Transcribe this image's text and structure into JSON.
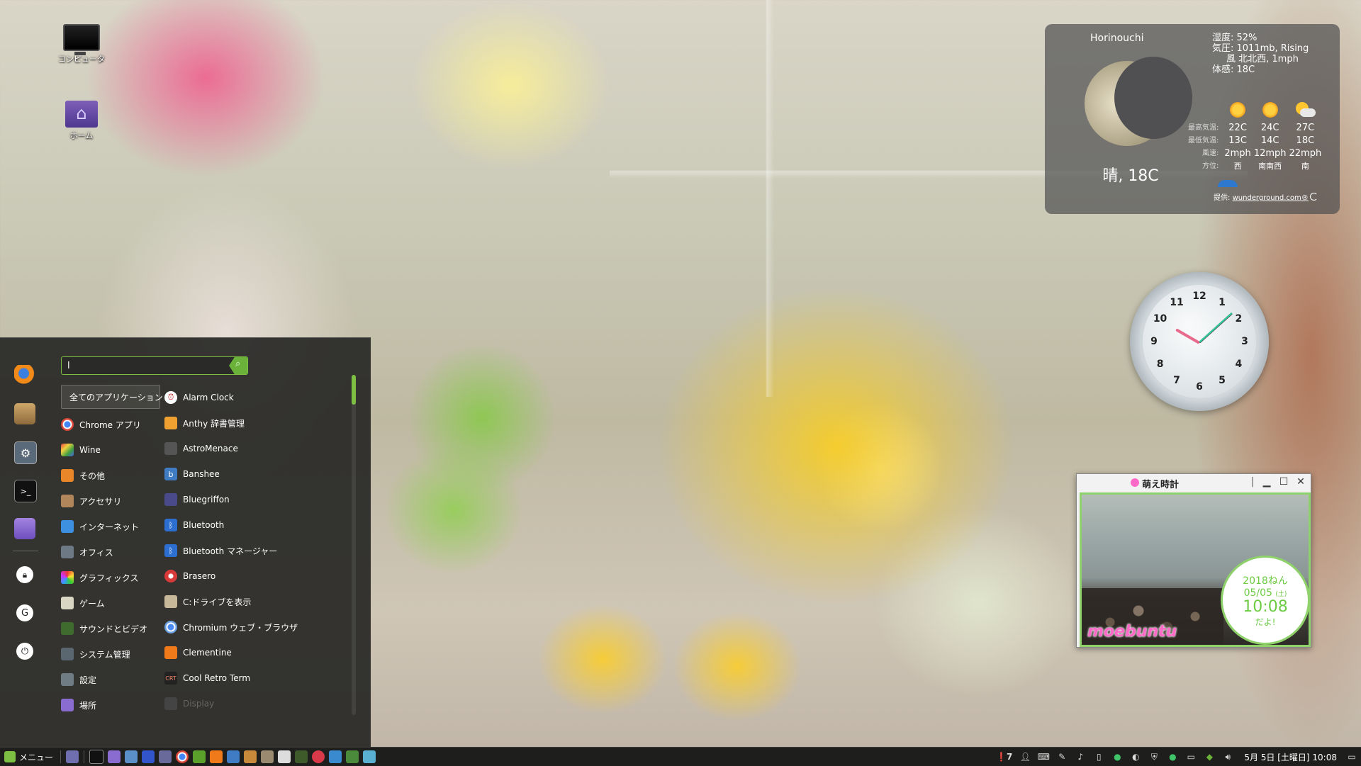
{
  "desktop": {
    "icons": [
      {
        "label": "コンピュータ"
      },
      {
        "label": "ホーム"
      }
    ]
  },
  "weather": {
    "city": "Horinouchi",
    "current": "晴, 18C",
    "details": [
      "湿度: 52%",
      "気圧: 1011mb, Rising",
      "風 北北西, 1mph",
      "体感: 18C"
    ],
    "row_labels": [
      "最高気温:",
      "最低気温:",
      "風速:",
      "方位:"
    ],
    "forecast": [
      {
        "icon": "sun-icon",
        "high": "22C",
        "low": "13C",
        "wind": "2mph",
        "dir": "西"
      },
      {
        "icon": "sun-icon",
        "high": "24C",
        "low": "14C",
        "wind": "12mph",
        "dir": "南南西"
      },
      {
        "icon": "partly-cloudy-icon",
        "high": "27C",
        "low": "18C",
        "wind": "22mph",
        "dir": "南"
      }
    ],
    "credit_prefix": "提供:",
    "credit_link": "wunderground.com®"
  },
  "analog_clock": {
    "numbers": [
      "12",
      "1",
      "2",
      "3",
      "4",
      "5",
      "6",
      "7",
      "8",
      "9",
      "10",
      "11"
    ]
  },
  "moe_clock": {
    "title": "萌え時計",
    "year": "2018ねん",
    "date": "05/05",
    "weekday": "(土)",
    "time": "10:08",
    "suffix": "だよ!",
    "logo": "moebuntu"
  },
  "menu": {
    "search_value": "l",
    "favorites": [
      "firefox-icon",
      "package-icon",
      "system-settings-icon",
      "terminal-icon",
      "folder-icon",
      "lock-icon",
      "logout-icon",
      "power-icon"
    ],
    "categories": [
      "全てのアプリケーション",
      "Chrome アプリ",
      "Wine",
      "その他",
      "アクセサリ",
      "インターネット",
      "オフィス",
      "グラフィックス",
      "ゲーム",
      "サウンドとビデオ",
      "システム管理",
      "設定",
      "場所"
    ],
    "apps": [
      {
        "label": "Alarm Clock",
        "icon": "alarm-clock-icon"
      },
      {
        "label": "Anthy 辞書管理",
        "icon": "anthy-icon"
      },
      {
        "label": "AstroMenace",
        "icon": "astromenace-icon"
      },
      {
        "label": "Banshee",
        "icon": "banshee-icon"
      },
      {
        "label": "Bluegriffon",
        "icon": "bluegriffon-icon"
      },
      {
        "label": "Bluetooth",
        "icon": "bluetooth-icon"
      },
      {
        "label": "Bluetooth マネージャー",
        "icon": "bluetooth-manager-icon"
      },
      {
        "label": "Brasero",
        "icon": "brasero-icon"
      },
      {
        "label": "C:ドライブを表示",
        "icon": "wine-drive-icon"
      },
      {
        "label": "Chromium ウェブ・ブラウザ",
        "icon": "chromium-icon"
      },
      {
        "label": "Clementine",
        "icon": "clementine-icon"
      },
      {
        "label": "Cool Retro Term",
        "icon": "cool-retro-term-icon"
      },
      {
        "label": "Display",
        "icon": "display-icon"
      }
    ]
  },
  "taskbar": {
    "menu_label": "メニュー",
    "notifications": "7",
    "clock": "5月 5日 [土曜日] 10:08"
  },
  "colors": {
    "accent": "#7cbf43",
    "menu_bg": "#282826",
    "moe_pink": "#ff6ac8"
  }
}
